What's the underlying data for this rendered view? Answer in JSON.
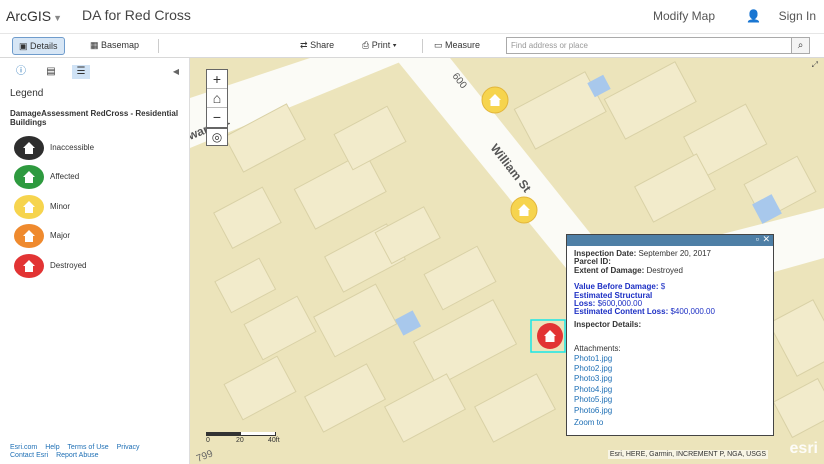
{
  "header": {
    "brand": "ArcGIS",
    "map_title": "DA for Red Cross",
    "modify_map": "Modify Map",
    "sign_in": "Sign In"
  },
  "toolbar": {
    "details": "Details",
    "basemap": "Basemap",
    "share": "Share",
    "print": "Print",
    "measure": "Measure",
    "search_placeholder": "Find address or place"
  },
  "legend": {
    "title": "Legend",
    "layer_title": "DamageAssessment RedCross - Residential Buildings",
    "items": [
      {
        "label": "Inaccessible",
        "color": "#2e2e2e"
      },
      {
        "label": "Affected",
        "color": "#2e9a3f"
      },
      {
        "label": "Minor",
        "color": "#f6d44e"
      },
      {
        "label": "Major",
        "color": "#ef8a2e"
      },
      {
        "label": "Destroyed",
        "color": "#e23434"
      }
    ]
  },
  "footer": {
    "links": [
      "Esri.com",
      "Help",
      "Terms of Use",
      "Privacy"
    ],
    "links2": [
      "Contact Esri",
      "Report Abuse"
    ]
  },
  "map": {
    "streets": [
      "William St",
      "600",
      "ward St",
      "799"
    ],
    "scale": [
      "0",
      "20",
      "40ft"
    ],
    "attribution": "Esri, HERE, Garmin, INCREMENT P, NGA, USGS",
    "logo": "esri"
  },
  "popup": {
    "inspection_label": "Inspection Date:",
    "inspection_value": "September 20, 2017",
    "parcel_label": "Parcel ID:",
    "extent_label": "Extent of Damage:",
    "extent_value": "Destroyed",
    "value_before_label": "Value Before Damage:",
    "value_before_value": "$",
    "structural_label_1": "Estimated Structural",
    "structural_label_2": "Loss:",
    "structural_value": "$600,000.00",
    "content_label": "Estimated Content Loss:",
    "content_value": "$400,000.00",
    "inspector_label": "Inspector Details:",
    "attachments_label": "Attachments:",
    "attachments": [
      "Photo1.jpg",
      "Photo2.jpg",
      "Photo3.jpg",
      "Photo4.jpg",
      "Photo5.jpg",
      "Photo6.jpg"
    ],
    "zoom_to": "Zoom to"
  }
}
